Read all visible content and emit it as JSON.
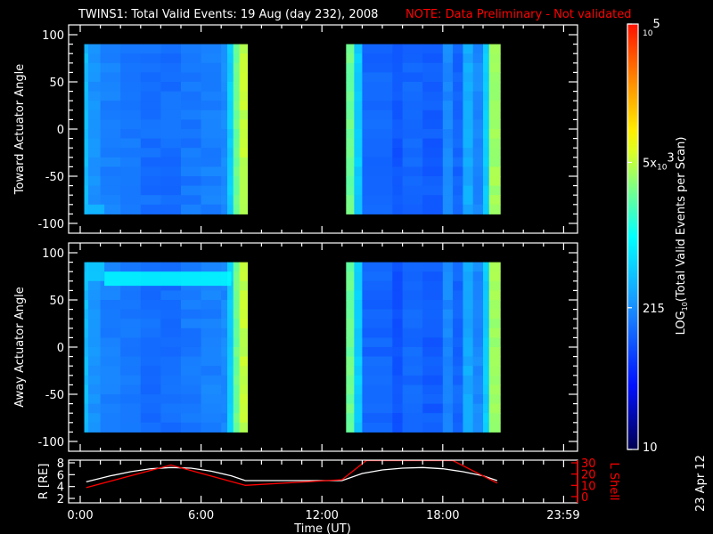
{
  "title": "TWINS1: Total Valid Events: 19 Aug (day 232), 2008",
  "note": "NOTE: Data Preliminary - Not validated",
  "date_stamp": "23 Apr 12",
  "colors": {
    "background": "#000000",
    "axis": "#ffffff",
    "note": "#ff0000",
    "r_line": "#ffffff",
    "l_shell_line": "#ff0000"
  },
  "chart_data": [
    {
      "type": "heatmap",
      "ylabel": "Toward Actuator Angle",
      "ylim": [
        -110,
        110
      ],
      "yticks": [
        "100",
        "50",
        "0",
        "-50",
        "-100"
      ],
      "ytick_values": [
        100,
        50,
        0,
        -50,
        -100
      ],
      "angle_range": [
        -90,
        90
      ],
      "xlim_hours": [
        0,
        24
      ],
      "value_units": "log10 counts",
      "columns": [
        [
          0.2,
          0.4,
          2.6
        ],
        [
          0.4,
          1,
          2.35
        ],
        [
          1,
          2,
          2.25
        ],
        [
          2,
          3,
          2.2
        ],
        [
          3,
          4,
          2.15
        ],
        [
          4,
          5,
          2.15
        ],
        [
          5,
          6,
          2.2
        ],
        [
          6,
          7,
          2.25
        ],
        [
          7,
          7.3,
          2.3
        ],
        [
          7.3,
          7.6,
          2.7
        ],
        [
          7.6,
          7.9,
          3.4
        ],
        [
          7.9,
          8.3,
          3.7
        ],
        [
          13.2,
          13.6,
          3.4
        ],
        [
          13.6,
          14,
          2.7
        ],
        [
          14,
          15.5,
          2.1
        ],
        [
          15.5,
          16,
          2.0
        ],
        [
          16,
          17,
          2.1
        ],
        [
          17,
          18,
          2.05
        ],
        [
          18,
          18.5,
          2.3
        ],
        [
          18.5,
          19,
          2.1
        ],
        [
          19,
          19.5,
          2.5
        ],
        [
          19.5,
          20,
          2.3
        ],
        [
          20,
          20.3,
          2.7
        ],
        [
          20.3,
          20.85,
          3.6
        ]
      ],
      "bands": [
        [
          0.2,
          1.2,
          -90,
          -80,
          2.6
        ]
      ]
    },
    {
      "type": "heatmap",
      "ylabel": "Away Actuator Angle",
      "ylim": [
        -110,
        110
      ],
      "yticks": [
        "100",
        "50",
        "0",
        "-50",
        "-100"
      ],
      "ytick_values": [
        100,
        50,
        0,
        -50,
        -100
      ],
      "angle_range": [
        -90,
        90
      ],
      "xlim_hours": [
        0,
        24
      ],
      "value_units": "log10 counts",
      "columns": [
        [
          0.2,
          0.4,
          2.6
        ],
        [
          0.4,
          1,
          2.35
        ],
        [
          1,
          2,
          2.25
        ],
        [
          2,
          3,
          2.2
        ],
        [
          3,
          4,
          2.15
        ],
        [
          4,
          5,
          2.15
        ],
        [
          5,
          6,
          2.2
        ],
        [
          6,
          7,
          2.25
        ],
        [
          7,
          7.3,
          2.3
        ],
        [
          7.3,
          7.6,
          2.7
        ],
        [
          7.6,
          7.9,
          3.4
        ],
        [
          7.9,
          8.3,
          3.7
        ],
        [
          13.2,
          13.6,
          3.4
        ],
        [
          13.6,
          14,
          2.7
        ],
        [
          14,
          15.5,
          2.1
        ],
        [
          15.5,
          16,
          2.0
        ],
        [
          16,
          17,
          2.1
        ],
        [
          17,
          18,
          2.05
        ],
        [
          18,
          18.5,
          2.3
        ],
        [
          18.5,
          19,
          2.1
        ],
        [
          19,
          19.5,
          2.5
        ],
        [
          19.5,
          20,
          2.3
        ],
        [
          20,
          20.3,
          2.7
        ],
        [
          20.3,
          20.85,
          3.6
        ]
      ],
      "bands": [
        [
          1.2,
          7.5,
          65,
          80,
          3.0
        ],
        [
          0.3,
          1.2,
          70,
          90,
          2.7
        ]
      ]
    },
    {
      "type": "line",
      "ylabel": "R [R_E]",
      "ylabel_text": "R [RE]",
      "ylim": [
        1.5,
        8.5
      ],
      "yticks": [
        "8",
        "6",
        "4",
        "2"
      ],
      "ytick_values": [
        8,
        6,
        4,
        2
      ],
      "y2label": "L Shell",
      "y2lim": [
        -2,
        32
      ],
      "y2ticks": [
        "30",
        "20",
        "10",
        "0"
      ],
      "y2tick_values": [
        30,
        20,
        10,
        0
      ],
      "xlabel": "Time (UT)",
      "xticks": [
        "0:00",
        "6:00",
        "12:00",
        "18:00",
        "23:59"
      ],
      "xtick_values": [
        0,
        6,
        12,
        18,
        23.98
      ],
      "series": [
        {
          "name": "R",
          "axis": "left",
          "x": [
            0.3,
            1.5,
            2.5,
            3.5,
            4.5,
            5.5,
            6.5,
            7.5,
            8.2,
            13.0,
            14,
            15,
            16,
            17,
            18,
            19,
            20,
            20.7
          ],
          "y": [
            4.8,
            5.8,
            6.5,
            7.0,
            7.2,
            7.1,
            6.6,
            5.8,
            5.0,
            5.0,
            6.2,
            6.8,
            7.1,
            7.2,
            7.0,
            6.5,
            5.8,
            5.0
          ]
        },
        {
          "name": "L Shell",
          "axis": "right",
          "x": [
            0.3,
            4.5,
            8.2,
            13.0,
            14.2,
            18.5,
            20.7
          ],
          "y": [
            8,
            28,
            10,
            15,
            32,
            32,
            12
          ]
        }
      ]
    },
    {
      "type": "colorbar",
      "label": "LOG10(Total Valid Events per Scan)",
      "label_main": "LOG",
      "label_sub": "10",
      "label_rest": "(Total Valid Events per Scan)",
      "range_log10": [
        1,
        5
      ],
      "ticks": [
        {
          "label": "10",
          "value": 10
        },
        {
          "label": "215",
          "value": 215
        },
        {
          "label": "5x10^3",
          "base": "5x",
          "mant": "10",
          "exp": "3",
          "value": 5000
        },
        {
          "label": "10^5",
          "mant": "10",
          "exp": "5",
          "value": 100000
        }
      ]
    }
  ]
}
